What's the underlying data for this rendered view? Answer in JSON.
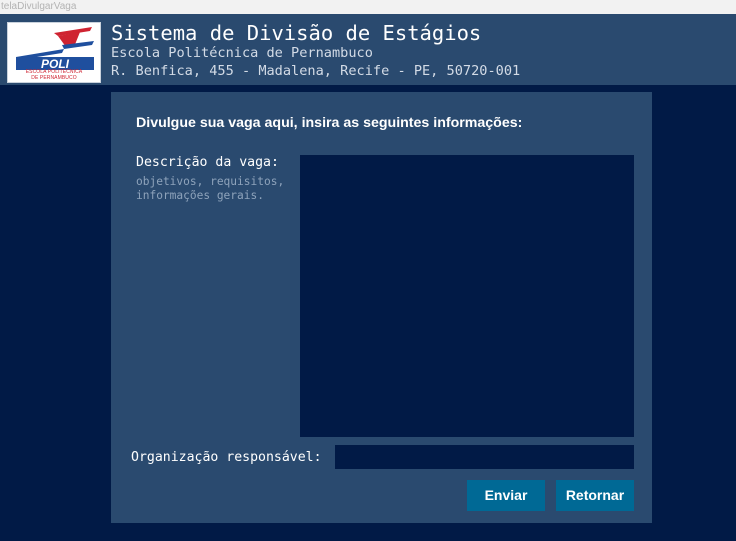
{
  "window": {
    "title": "telaDivulgarVaga"
  },
  "header": {
    "logo": {
      "text": "POLI",
      "caption_line1": "ESCOLA POLITÉCNICA",
      "caption_line2": "DE PERNAMBUCO"
    },
    "title": "Sistema de Divisão de Estágios",
    "subtitle": "Escola Politécnica de Pernambuco",
    "address": "R. Benfica, 455 - Madalena, Recife - PE, 50720-001"
  },
  "form": {
    "heading": "Divulgue sua vaga aqui, insira as seguintes informações:",
    "description": {
      "label": "Descrição da vaga:",
      "hint_line1": "objetivos, requisitos,",
      "hint_line2": "informações gerais.",
      "value": ""
    },
    "organization": {
      "label": "Organização responsável:",
      "value": ""
    },
    "buttons": {
      "send": "Enviar",
      "back": "Retornar"
    }
  },
  "colors": {
    "background": "#011a46",
    "panel": "#2a4a6f",
    "button": "#006995",
    "logo_red": "#cf2331",
    "logo_blue": "#1f4f9e"
  }
}
